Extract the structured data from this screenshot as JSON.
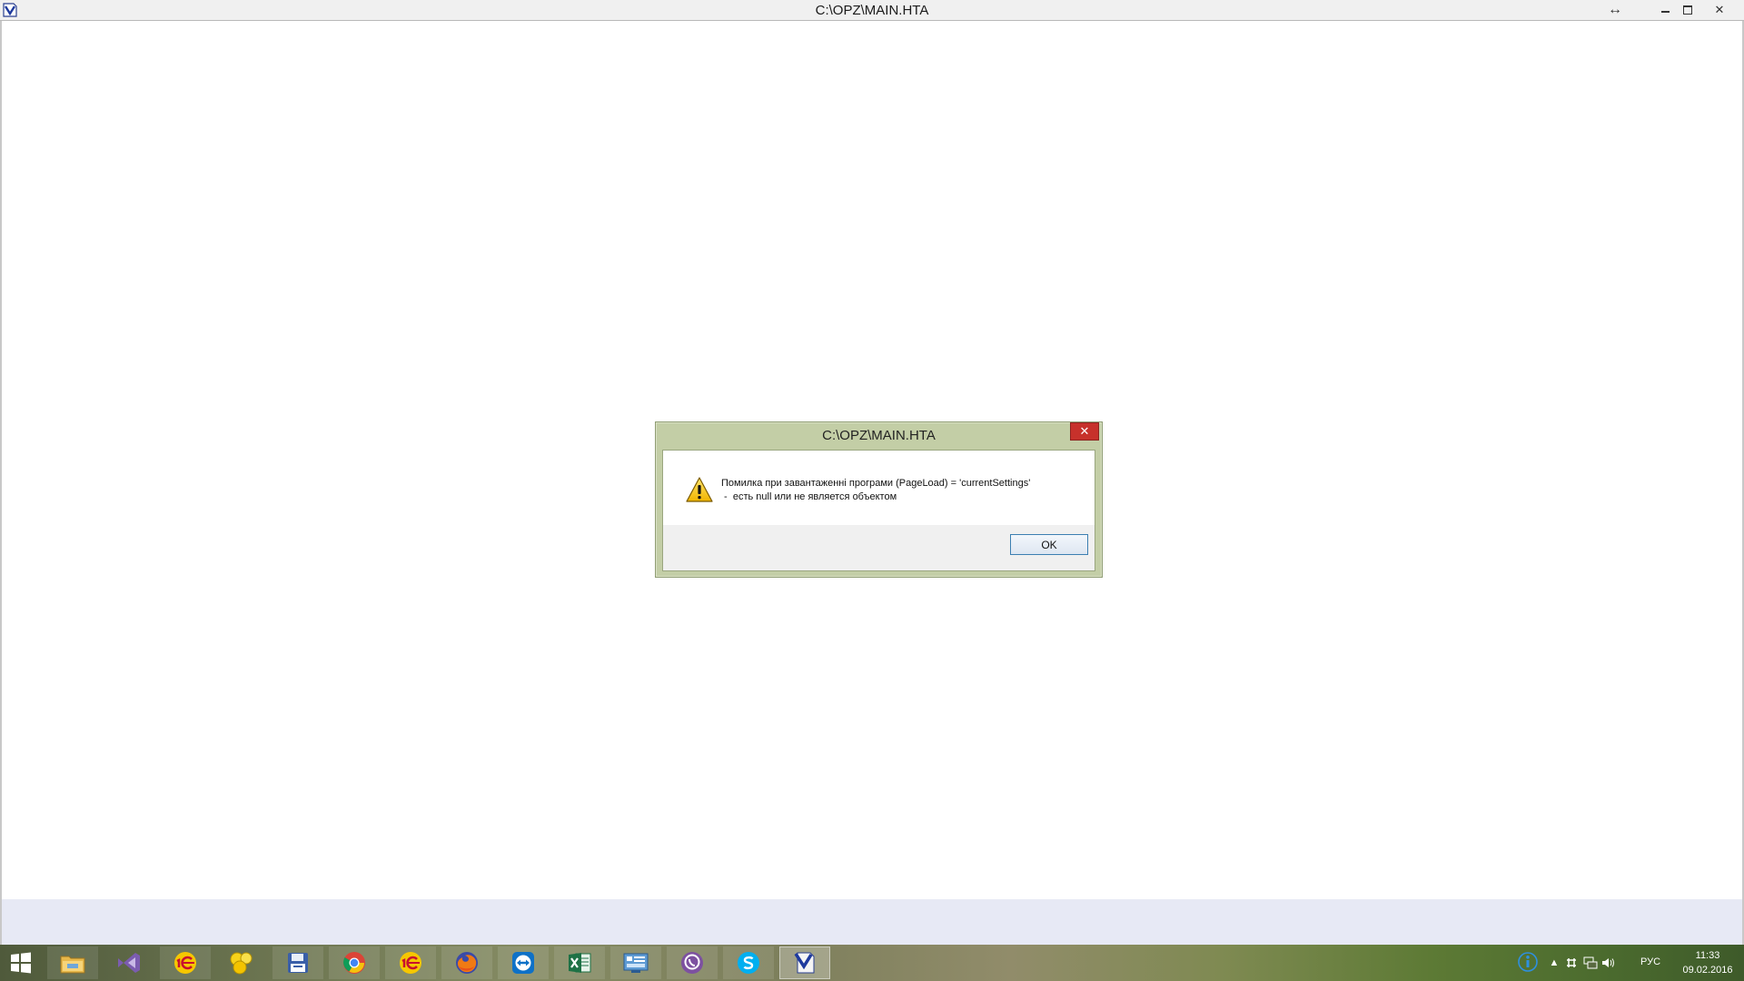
{
  "window": {
    "title": "C:\\OPZ\\MAIN.HTA",
    "resize_glyph": "↔",
    "close_glyph": "✕",
    "icon": "hta-app-icon"
  },
  "dialog": {
    "title": "C:\\OPZ\\MAIN.HTA",
    "close_glyph": "✕",
    "icon": "warning-icon",
    "message_line1": "Помилка при завантаженні програми (PageLoad) = 'currentSettings'",
    "message_line2": " -  есть null или не является объектом",
    "ok_label": "OK"
  },
  "taskbar": {
    "items": [
      {
        "icon": "windows-start-icon"
      },
      {
        "icon": "file-explorer-icon"
      },
      {
        "icon": "visual-studio-icon"
      },
      {
        "icon": "1c-enterprise-icon"
      },
      {
        "icon": "yellow-flower-icon"
      },
      {
        "icon": "floppy-disk-icon"
      },
      {
        "icon": "chrome-icon"
      },
      {
        "icon": "1c-enterprise-icon"
      },
      {
        "icon": "firefox-icon"
      },
      {
        "icon": "teamviewer-icon"
      },
      {
        "icon": "excel-icon"
      },
      {
        "icon": "control-panel-icon"
      },
      {
        "icon": "viber-icon"
      },
      {
        "icon": "skype-icon"
      },
      {
        "icon": "hta-app-icon"
      }
    ],
    "tray": {
      "language": "РУС",
      "time": "11:33",
      "date": "09.02.2016"
    },
    "colors": {
      "accent": "#3c7fb1",
      "dialog_frame": "#c3cea6",
      "close_red": "#c7312b"
    }
  }
}
